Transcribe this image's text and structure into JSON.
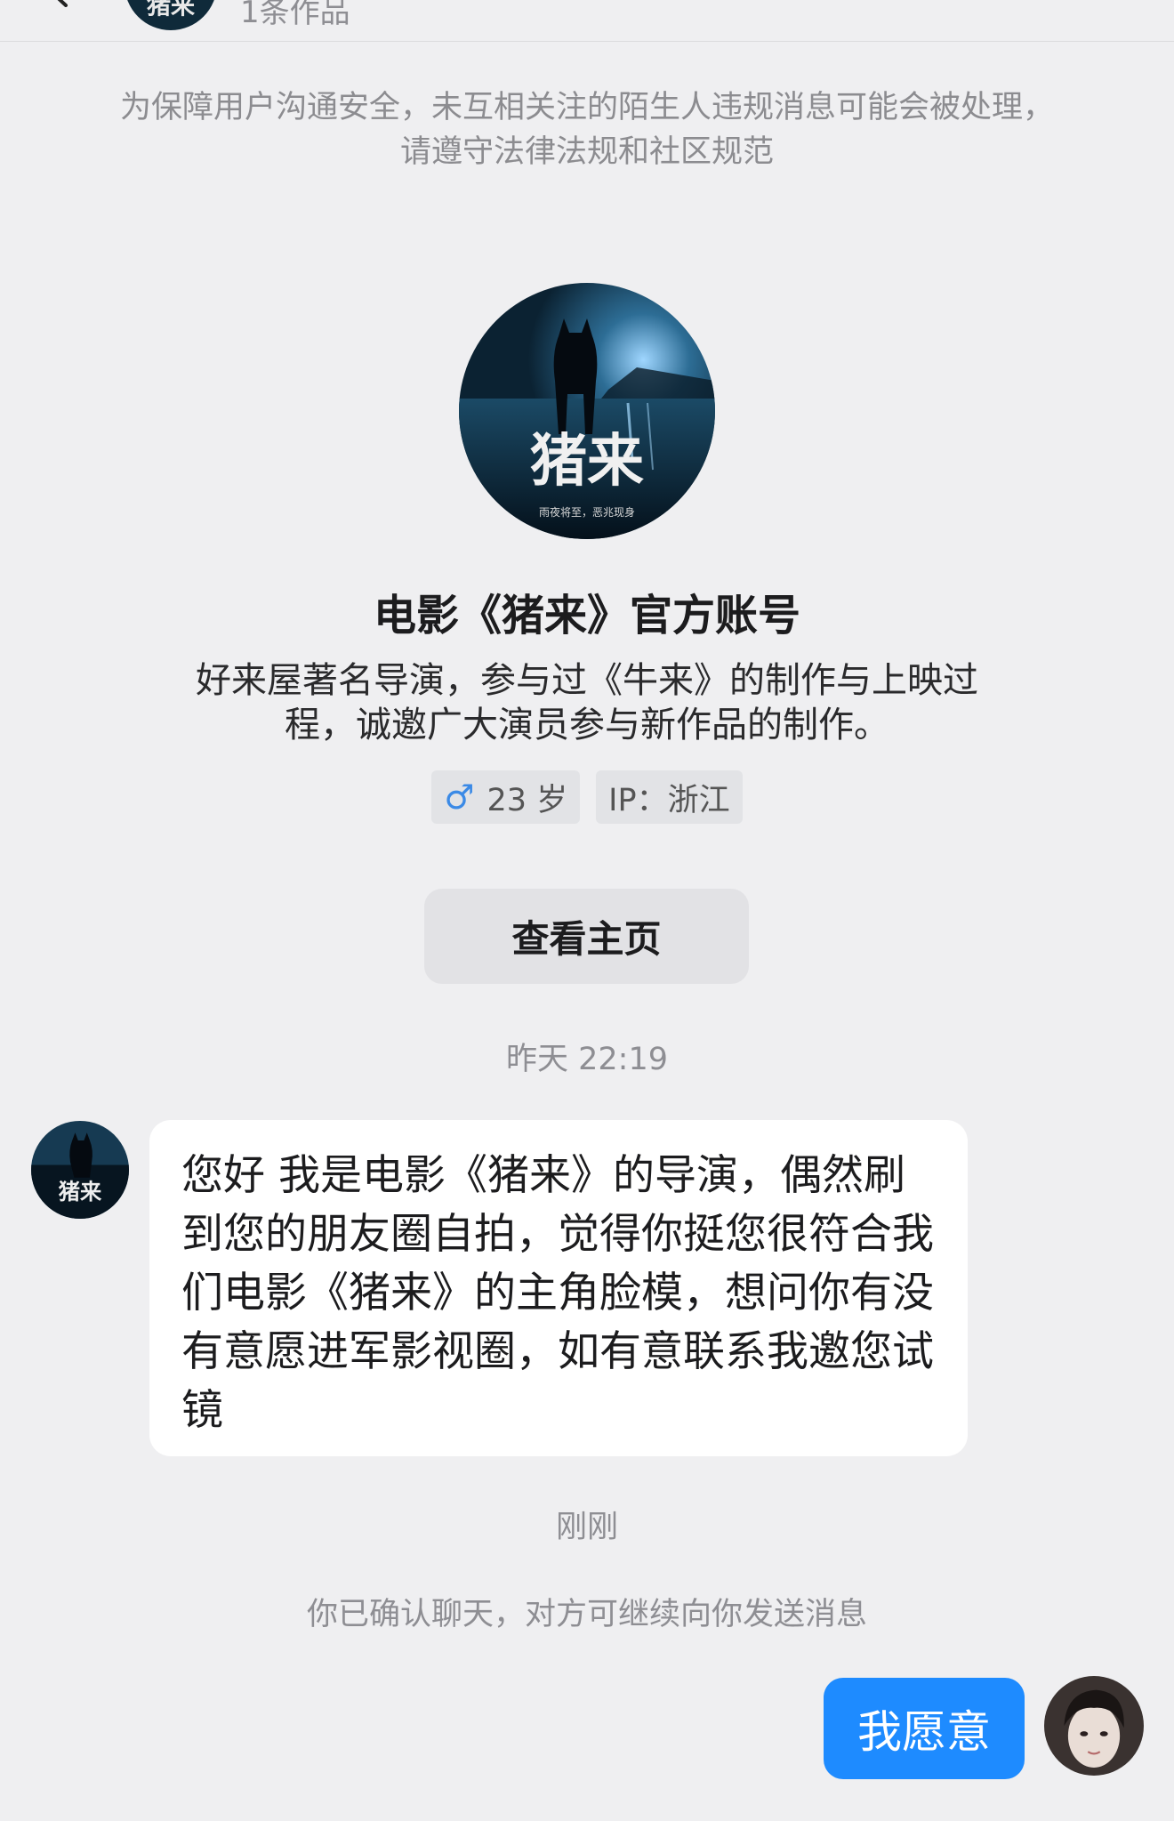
{
  "header": {
    "subtitle": "1条作品",
    "avatar_title": "猪来"
  },
  "notice": "为保障用户沟通安全，未互相关注的陌生人违规消息可能会被处理，请遵守法律法规和社区规范",
  "profile": {
    "avatar_title": "猪来",
    "avatar_tagline": "雨夜将至，恶兆现身",
    "name": "电影《猪来》官方账号",
    "bio": "好来屋著名导演，参与过《牛来》的制作与上映过程，诚邀广大演员参与新作品的制作。",
    "gender_icon": "male-icon",
    "age": "23 岁",
    "ip": "IP：浙江",
    "view_home_label": "查看主页"
  },
  "messages": {
    "timestamp_1": "昨天 22:19",
    "incoming_text": "您好 我是电影《猪来》的导演，偶然刷到您的朋友圈自拍，觉得你挺您很符合我们电影《猪来》的主角脸模，想问你有没有意愿进军影视圈，如有意联系我邀您试镜",
    "timestamp_2": "刚刚",
    "confirm_note": "你已确认聊天，对方可继续向你发送消息",
    "outgoing_text": "我愿意"
  },
  "colors": {
    "background": "#efeff1",
    "bubble_outgoing": "#1e8bff",
    "bubble_incoming": "#ffffff",
    "gender_male": "#3b8ae6"
  }
}
